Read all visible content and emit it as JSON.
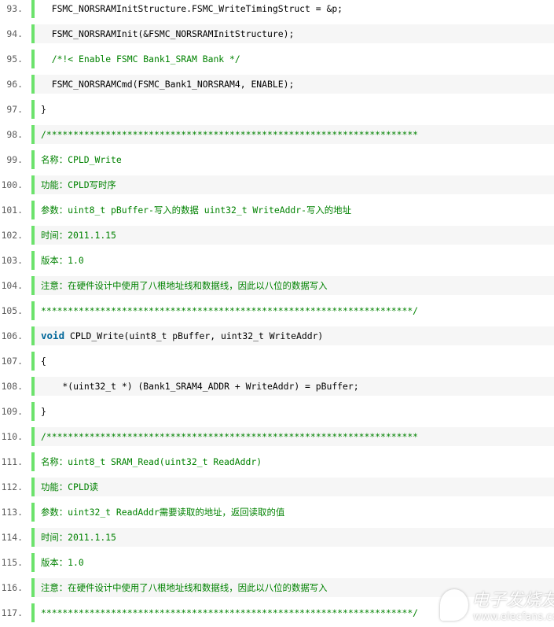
{
  "lines": [
    {
      "n": "93.",
      "text": "  FSMC_NORSRAMInitStructure.FSMC_WriteTimingStruct = &p;",
      "type": "code"
    },
    {
      "n": "94.",
      "text": "  FSMC_NORSRAMInit(&FSMC_NORSRAMInitStructure);",
      "type": "code"
    },
    {
      "n": "95.",
      "text": "  /*!< Enable FSMC Bank1_SRAM Bank */",
      "type": "comment"
    },
    {
      "n": "96.",
      "text": "  FSMC_NORSRAMCmd(FSMC_Bank1_NORSRAM4, ENABLE);",
      "type": "code"
    },
    {
      "n": "97.",
      "text": "}",
      "type": "code"
    },
    {
      "n": "98.",
      "text": "/*********************************************************************",
      "type": "comment"
    },
    {
      "n": "99.",
      "text": "名称：CPLD_Write",
      "type": "comment"
    },
    {
      "n": "100.",
      "text": "功能：CPLD写时序",
      "type": "comment"
    },
    {
      "n": "101.",
      "text": "参数：uint8_t pBuffer-写入的数据 uint32_t WriteAddr-写入的地址",
      "type": "comment"
    },
    {
      "n": "102.",
      "text": "时间：2011.1.15",
      "type": "comment"
    },
    {
      "n": "103.",
      "text": "版本：1.0",
      "type": "comment"
    },
    {
      "n": "104.",
      "text": "注意：在硬件设计中使用了八根地址线和数据线，因此以八位的数据写入",
      "type": "comment"
    },
    {
      "n": "105.",
      "text": "*********************************************************************/",
      "type": "comment"
    },
    {
      "n": "106.",
      "kw": "void",
      "text": " CPLD_Write(uint8_t pBuffer, uint32_t WriteAddr)",
      "type": "code"
    },
    {
      "n": "107.",
      "text": "{",
      "type": "code"
    },
    {
      "n": "108.",
      "text": "    *(uint32_t *) (Bank1_SRAM4_ADDR + WriteAddr) = pBuffer;",
      "type": "code"
    },
    {
      "n": "109.",
      "text": "}",
      "type": "code"
    },
    {
      "n": "110.",
      "text": "/*********************************************************************",
      "type": "comment"
    },
    {
      "n": "111.",
      "text": "名称：uint8_t SRAM_Read(uint32_t ReadAddr)",
      "type": "comment"
    },
    {
      "n": "112.",
      "text": "功能：CPLD读",
      "type": "comment"
    },
    {
      "n": "113.",
      "text": "参数：uint32_t ReadAddr需要读取的地址，返回读取的值",
      "type": "comment"
    },
    {
      "n": "114.",
      "text": "时间：2011.1.15",
      "type": "comment"
    },
    {
      "n": "115.",
      "text": "版本：1.0",
      "type": "comment"
    },
    {
      "n": "116.",
      "text": "注意：在硬件设计中使用了八根地址线和数据线，因此以八位的数据写入",
      "type": "comment"
    },
    {
      "n": "117.",
      "text": "*********************************************************************/",
      "type": "comment"
    }
  ],
  "watermark": {
    "title": "电子发烧友",
    "url": "www.elecfans.com"
  },
  "colors": {
    "bar": "#6ce26c",
    "comment": "#008200",
    "keyword": "#006699",
    "alt_bg": "#f6f6f6"
  }
}
